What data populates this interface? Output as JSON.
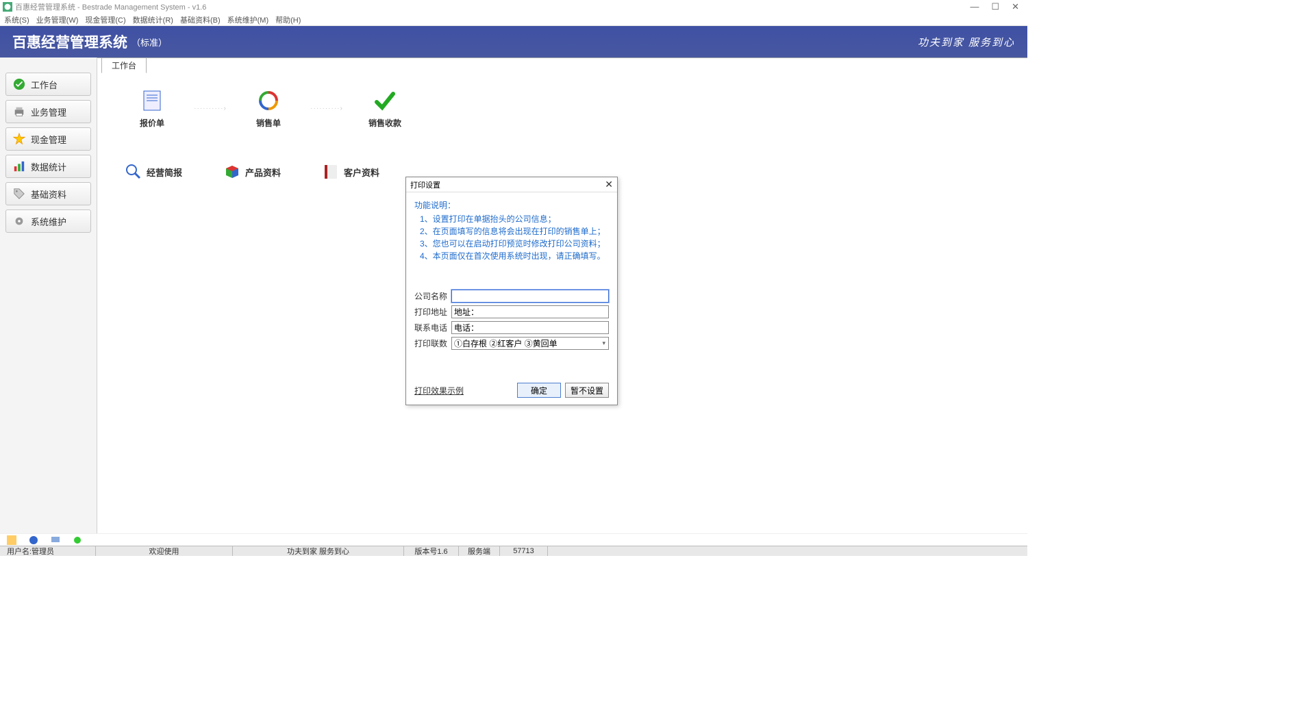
{
  "window": {
    "title": "百惠经营管理系统 - Bestrade Management System - v1.6"
  },
  "menu": {
    "items": [
      "系统(S)",
      "业务管理(W)",
      "现金管理(C)",
      "数据统计(R)",
      "基础资料(B)",
      "系统维护(M)",
      "帮助(H)"
    ]
  },
  "header": {
    "brand": "百惠经营管理系统",
    "brand_sub": "（标准）",
    "slogan": "功夫到家 服务到心"
  },
  "sidebar": {
    "items": [
      {
        "label": "工作台"
      },
      {
        "label": "业务管理"
      },
      {
        "label": "现金管理"
      },
      {
        "label": "数据统计"
      },
      {
        "label": "基础资料"
      },
      {
        "label": "系统维护"
      }
    ]
  },
  "tab": {
    "label": "工作台"
  },
  "workbench": {
    "row1": [
      {
        "label": "报价单"
      },
      {
        "label": "销售单"
      },
      {
        "label": "销售收款"
      }
    ],
    "row2": [
      {
        "label": "经营简报"
      },
      {
        "label": "产品资料"
      },
      {
        "label": "客户资料"
      }
    ]
  },
  "dialog": {
    "title": "打印设置",
    "func_title": "功能说明：",
    "func_items": [
      "1、设置打印在单据抬头的公司信息；",
      "2、在页面填写的信息将会出现在打印的销售单上；",
      "3、您也可以在启动打印预览时修改打印公司资料；",
      "4、本页面仅在首次使用系统时出现，请正确填写。"
    ],
    "fields": {
      "company_label": "公司名称",
      "company_value": "",
      "address_label": "打印地址",
      "address_value": "地址：",
      "phone_label": "联系电话",
      "phone_value": "电话：",
      "copies_label": "打印联数",
      "copies_value": "①白存根 ②红客户 ③黄回单"
    },
    "link": "打印效果示例",
    "ok": "确定",
    "cancel": "暂不设置"
  },
  "status": {
    "user": "用户名:管理员",
    "welcome": "欢迎使用",
    "slogan": "功夫到家 服务到心",
    "version": "版本号1.6",
    "server": "服务端",
    "port": "57713"
  }
}
